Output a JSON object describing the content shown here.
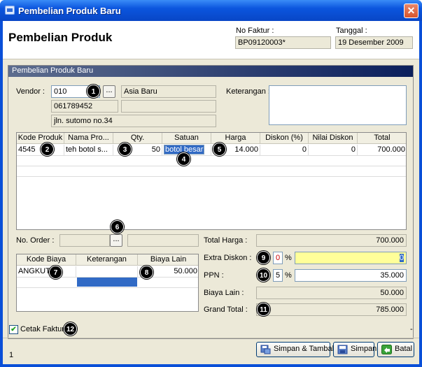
{
  "window": {
    "title": "Pembelian Produk Baru",
    "close": "✕"
  },
  "header": {
    "title": "Pembelian Produk",
    "no_faktur_label": "No Faktur :",
    "no_faktur_value": "BP09120003*",
    "tanggal_label": "Tanggal :",
    "tanggal_value": "19 Desember 2009"
  },
  "group": {
    "title": "Pembelian Produk Baru"
  },
  "vendor": {
    "label": "Vendor :",
    "code": "010",
    "browse": "...",
    "name": "Asia Baru",
    "phone": "061789452",
    "address": "jln. sutomo no.34"
  },
  "keterangan": {
    "label": "Keterangan :",
    "value": ""
  },
  "product_grid": {
    "columns": [
      "Kode Produk",
      "Nama Pro...",
      "Qty.",
      "Satuan",
      "Harga",
      "Diskon (%)",
      "Nilai Diskon",
      "Total"
    ],
    "rows": [
      [
        "4545",
        "teh botol s...",
        "50",
        "botol besar",
        "14.000",
        "0",
        "0",
        "700.000"
      ]
    ]
  },
  "order": {
    "label": "No. Order :",
    "browse": "..."
  },
  "cost_grid": {
    "columns": [
      "Kode Biaya",
      "Keterangan",
      "Biaya Lain"
    ],
    "rows": [
      [
        "ANGKUT",
        "",
        "50.000"
      ]
    ]
  },
  "summary": {
    "total_harga_label": "Total Harga :",
    "total_harga": "700.000",
    "extra_diskon_label": "Extra Diskon :",
    "extra_diskon_pct": "0",
    "extra_diskon_value": "0",
    "ppn_label": "PPN :",
    "ppn_pct": "5",
    "ppn_value": "35.000",
    "biaya_lain_label": "Biaya Lain :",
    "biaya_lain": "50.000",
    "grand_total_label": "Grand Total :",
    "grand_total": "785.000",
    "pct_sign": "%"
  },
  "footer": {
    "cetak_label": "Cetak Faktur",
    "cetak_checked": "✔",
    "status_left": "1",
    "status_right": "-",
    "btn_simpan_tambah": "Simpan & Tambah",
    "btn_simpan": "Simpan",
    "btn_batal": "Batal"
  },
  "badges": [
    "1",
    "2",
    "3",
    "4",
    "5",
    "6",
    "7",
    "8",
    "9",
    "10",
    "11",
    "12"
  ],
  "colors": {
    "titlebar": "#0b55de",
    "highlight": "#ffff99",
    "selection": "#316ac5"
  }
}
